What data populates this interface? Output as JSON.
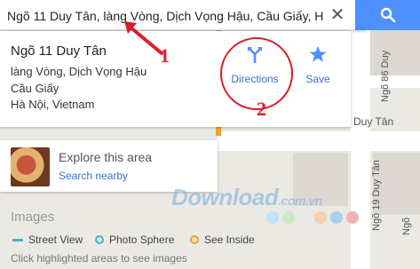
{
  "search": {
    "value": "Ngõ 11 Duy Tân, làng Vòng, Dịch Vọng Hậu, Cầu Giấy, H"
  },
  "place": {
    "name": "Ngõ 11 Duy Tân",
    "address_lines": [
      "làng Vòng, Dịch Vọng Hậu",
      "Cầu Giấy",
      "Hà Nội, Vietnam"
    ],
    "actions": {
      "directions_label": "Directions",
      "save_label": "Save"
    }
  },
  "explore": {
    "title": "Explore this area",
    "link": "Search nearby"
  },
  "images": {
    "title": "Images",
    "legend": {
      "street_view": "Street View",
      "photo_sphere": "Photo Sphere",
      "see_inside": "See Inside"
    },
    "hint": "Click highlighted areas to see images"
  },
  "map": {
    "street_labels": {
      "ngo86": "Ngõ 86 Duy",
      "duytan": "Duy Tân",
      "ngo19": "Ngõ 19 Duy Tân",
      "ngo_small": "Ngõ"
    }
  },
  "annotations": {
    "one": "1",
    "two": "2"
  },
  "watermark": {
    "main": "Download",
    "suffix": ".com.vn"
  },
  "icons": {
    "search": "search-icon",
    "clear": "close-icon",
    "directions": "directions-icon",
    "save": "star-icon"
  },
  "colors": {
    "accent": "#4d90fe",
    "link": "#3a6fd3",
    "annotation_red": "#d81f2a"
  }
}
